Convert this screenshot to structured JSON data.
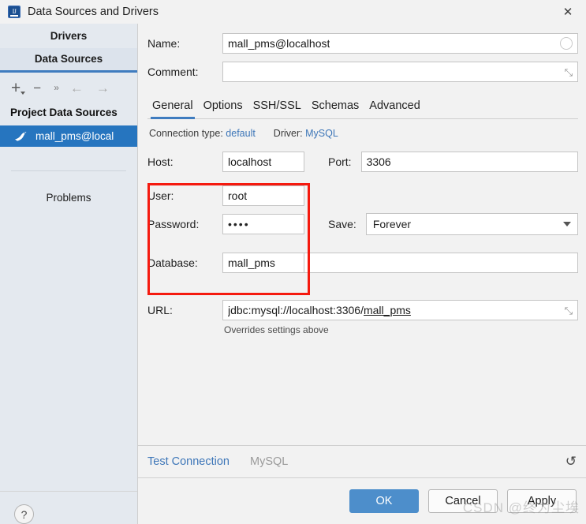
{
  "window": {
    "title": "Data Sources and Drivers",
    "app_icon": "intellij-idea-icon",
    "close_label": "✕"
  },
  "sidebar": {
    "tabs": [
      {
        "label": "Drivers",
        "active": false
      },
      {
        "label": "Data Sources",
        "active": true
      }
    ],
    "toolbar": [
      {
        "name": "add-button",
        "glyph": "+"
      },
      {
        "name": "remove-button",
        "glyph": "−"
      },
      {
        "name": "more-button",
        "glyph": "»"
      },
      {
        "name": "back-button",
        "glyph": "←"
      },
      {
        "name": "forward-button",
        "glyph": "→"
      }
    ],
    "group_header": "Project Data Sources",
    "data_source": {
      "label": "mall_pms@local",
      "icon": "mysql-dolphin-icon",
      "selected": true
    },
    "problems_label": "Problems",
    "help_label": "?"
  },
  "form": {
    "name_label": "Name:",
    "name_value": "mall_pms@localhost",
    "name_placeholder": "",
    "comment_label": "Comment:",
    "comment_value": "",
    "comment_placeholder": ""
  },
  "tabs": [
    {
      "label": "General",
      "active": true
    },
    {
      "label": "Options",
      "active": false
    },
    {
      "label": "SSH/SSL",
      "active": false
    },
    {
      "label": "Schemas",
      "active": false
    },
    {
      "label": "Advanced",
      "active": false
    }
  ],
  "general": {
    "connection_type_label": "Connection type:",
    "connection_type_value": "default",
    "driver_label": "Driver:",
    "driver_value": "MySQL",
    "host_label": "Host:",
    "host_value": "localhost",
    "port_label": "Port:",
    "port_value": "3306",
    "user_label": "User:",
    "user_value": "root",
    "password_label": "Password:",
    "password_value": "••••",
    "save_label": "Save:",
    "save_value": "Forever",
    "database_label": "Database:",
    "database_value": "mall_pms",
    "url_label": "URL:",
    "url_value_prefix": "jdbc:mysql://localhost:3306/",
    "url_value_db": "mall_pms",
    "url_hint": "Overrides settings above"
  },
  "footer": {
    "test_connection_label": "Test Connection",
    "driver_name": "MySQL",
    "revert_icon": "↺",
    "buttons": [
      {
        "label": "OK",
        "primary": true
      },
      {
        "label": "Cancel",
        "primary": false
      },
      {
        "label": "Apply",
        "primary": false
      }
    ]
  },
  "annotation": {
    "highlight_color": "#f51a0f",
    "highlights": [
      "user",
      "password",
      "database"
    ]
  },
  "watermark": "CSDN @终为尘埃"
}
